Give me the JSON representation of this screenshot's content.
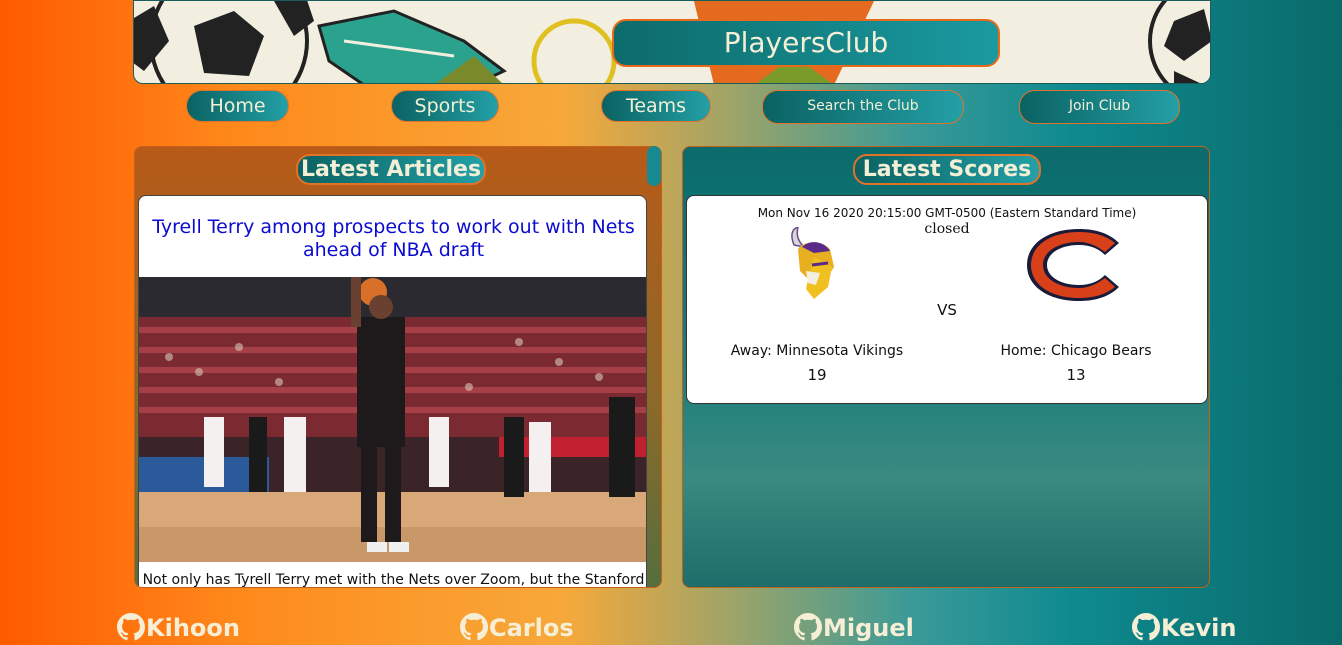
{
  "header": {
    "brand": "PlayersClub"
  },
  "nav": {
    "home": "Home",
    "sports": "Sports",
    "teams": "Teams",
    "search": "Search the Club",
    "join": "Join Club"
  },
  "articles": {
    "heading": "Latest Articles",
    "items": [
      {
        "title": "Tyrell Terry among prospects to work out with Nets ahead of NBA draft",
        "snippet": "Not only has Tyrell Terry met with the Nets over Zoom, but the Stanford",
        "image_icon": "basketball-free-throw-photo"
      }
    ]
  },
  "scores": {
    "heading": "Latest Scores",
    "games": [
      {
        "date": "Mon Nov 16 2020 20:15:00 GMT-0500 (Eastern Standard Time)",
        "status": "closed",
        "vs": "VS",
        "away_label": "Away: Minnesota Vikings",
        "away_score": "19",
        "home_label": "Home: Chicago Bears",
        "home_score": "13"
      }
    ]
  },
  "footer": {
    "links": [
      "Kihoon",
      "Carlos",
      "Miguel",
      "Kevin"
    ],
    "icon": "github-icon"
  },
  "colors": {
    "accent_orange": "#e0722a",
    "teal": "#0b6262",
    "link_blue": "#0a0ad0",
    "cream": "#f3efd6"
  }
}
